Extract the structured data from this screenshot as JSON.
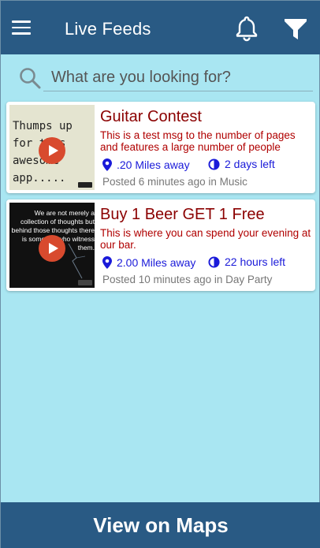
{
  "header": {
    "title": "Live Feeds",
    "menu_icon": "hamburger-menu-icon",
    "bell_icon": "bell-icon",
    "filter_icon": "filter-icon"
  },
  "search": {
    "placeholder": "What are you looking for?",
    "value": "",
    "icon": "search-icon"
  },
  "feeds": [
    {
      "title": "Guitar Contest",
      "description": "This is a test msg to the number of pages and features a large number of people",
      "distance": ".20 Miles away",
      "time_left": "2 days left",
      "posted": "Posted 6 minutes ago in Music",
      "thumbnail_text": "Thumps up for this awesome app....."
    },
    {
      "title": "Buy 1 Beer GET 1 Free",
      "description": "This is where you can spend your evening at our bar.",
      "distance": "2.00 Miles away",
      "time_left": "22 hours left",
      "posted": "Posted 10 minutes ago in Day Party",
      "thumbnail_text": "We are not merely a collection of thoughts but behind those thoughts there is someone who witness them."
    }
  ],
  "colors": {
    "header_bg": "#295a84",
    "page_bg": "#a9e6f2",
    "title_text": "#8b0000",
    "meta_text": "#1a1ad9"
  },
  "footer": {
    "button_label": "View on Maps"
  }
}
